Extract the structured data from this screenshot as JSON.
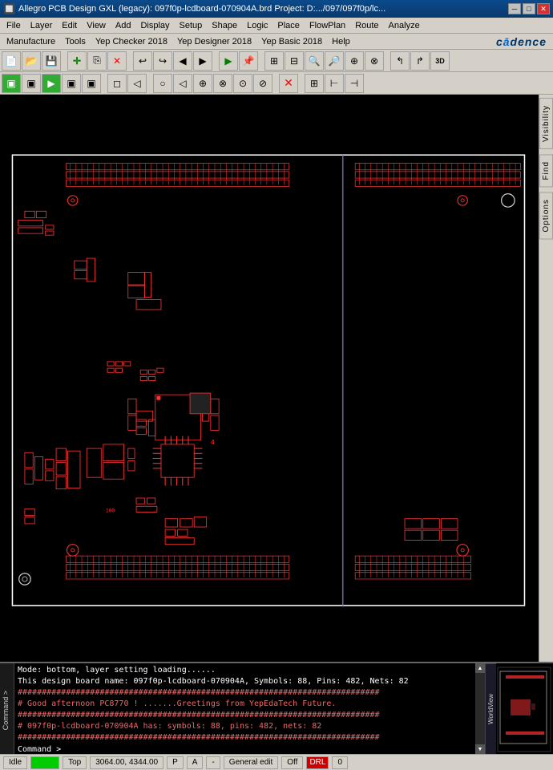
{
  "titlebar": {
    "icon": "🔲",
    "title": "Allegro PCB Design GXL (legacy): 097f0p-lcdboard-070904A.brd  Project: D:.../097/097f0p/lc...",
    "minimize": "─",
    "maximize": "□",
    "close": "✕"
  },
  "menubar1": {
    "items": [
      "File",
      "Layer",
      "Edit",
      "View",
      "Add",
      "Display",
      "Setup",
      "Shape",
      "Logic",
      "Place",
      "FlowPlan",
      "Route",
      "Analyze"
    ]
  },
  "menubar2": {
    "items": [
      "Manufacture",
      "Tools",
      "Yep Checker 2018",
      "Yep Designer 2018",
      "Yep Basic 2018",
      "Help"
    ],
    "logo": "cadence"
  },
  "sidebar_tabs": [
    "Visibility",
    "Find",
    "Options"
  ],
  "console": {
    "lines": [
      {
        "text": "Mode: bottom, layer setting loading......",
        "type": "normal"
      },
      {
        "text": "This design board name: 097f0p-lcdboard-070904A, Symbols: 88, Pins: 482, Nets: 82",
        "type": "normal"
      },
      {
        "text": "###########################################################################",
        "type": "hash"
      },
      {
        "text": "#  Good afternoon PC8770 !        .......Greetings from YepEdaTech Future.",
        "type": "hash"
      },
      {
        "text": "###########################################################################",
        "type": "hash"
      },
      {
        "text": "#  097f0p-lcdboard-070904A has: symbols: 88, pins: 482, nets: 82",
        "type": "hash"
      },
      {
        "text": "###########################################################################",
        "type": "hash"
      }
    ],
    "prompt": "Command > ",
    "command_label": "Command >"
  },
  "statusbar": {
    "idle": "Idle",
    "led_value": "",
    "layer": "Top",
    "coords": "3064.00, 4344.00",
    "mode_p": "P",
    "mode_a": "A",
    "separator": "-",
    "edit_mode": "General edit",
    "off": "Off",
    "drl": "DRL",
    "number": "0"
  },
  "worldview_label": "WorldView"
}
